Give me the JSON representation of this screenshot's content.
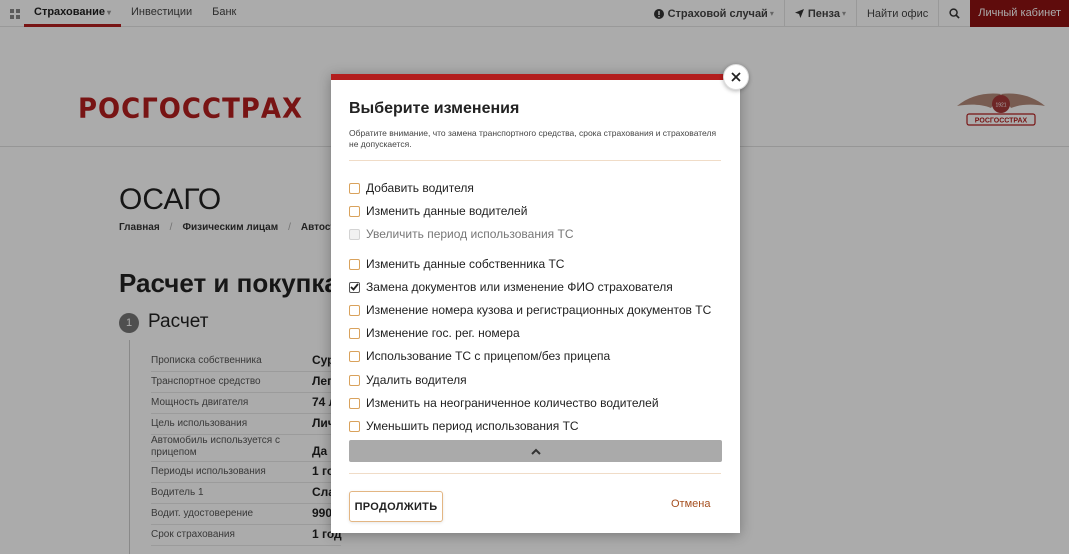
{
  "topnav": {
    "items": [
      {
        "label": "Страхование",
        "active": true,
        "has_dropdown": true
      },
      {
        "label": "Инвестиции",
        "active": false,
        "has_dropdown": false
      },
      {
        "label": "Банк",
        "active": false,
        "has_dropdown": false
      }
    ],
    "insurance_case": "Страховой случай",
    "city": "Пенза",
    "find_office": "Найти офис",
    "cabinet": "Личный кабинет"
  },
  "header": {
    "logo": "РОСГОССТРАХ",
    "emblem_text": "РОСГОССТРАХ",
    "emblem_year": "1921"
  },
  "page": {
    "title": "ОСАГО",
    "breadcrumb": [
      "Главная",
      "Физическим лицам",
      "Автострах"
    ],
    "heading": "Расчет и покупка о",
    "step_number": "1",
    "step_label": "Расчет",
    "summary": [
      {
        "key": "Прописка собственника",
        "value": "Сур"
      },
      {
        "key": "Транспортное средство",
        "value": "Лег"
      },
      {
        "key": "Мощность двигателя",
        "value": "74 л"
      },
      {
        "key": "Цель использования",
        "value": "Лич"
      },
      {
        "key": "Автомобиль используется с прицепом",
        "value": "Да"
      },
      {
        "key": "Периоды использования",
        "value": "1 го"
      },
      {
        "key": "Водитель 1",
        "value": "Сла"
      },
      {
        "key": "Водит. удостоверение",
        "value": "990"
      },
      {
        "key": "Срок страхования",
        "value": "1 год"
      }
    ]
  },
  "modal": {
    "title": "Выберите изменения",
    "note": "Обратите внимание, что замена транспортного средства, срока страхования и страхователя не допускается.",
    "options": [
      {
        "label": "Добавить водителя",
        "checked": false,
        "disabled": false
      },
      {
        "label": "Изменить данные водителей",
        "checked": false,
        "disabled": false
      },
      {
        "label": "Увеличить период использования ТС",
        "checked": false,
        "disabled": true
      },
      {
        "label": "Изменить данные собственника ТС",
        "checked": false,
        "disabled": false
      },
      {
        "label": "Замена документов или изменение ФИО страхователя",
        "checked": true,
        "disabled": false
      },
      {
        "label": "Изменение номера кузова и регистрационных документов ТС",
        "checked": false,
        "disabled": false
      },
      {
        "label": "Изменение гос. рег. номера",
        "checked": false,
        "disabled": false
      },
      {
        "label": "Использование ТС с прицепом/без прицепа",
        "checked": false,
        "disabled": false
      },
      {
        "label": "Удалить водителя",
        "checked": false,
        "disabled": false
      },
      {
        "label": "Изменить на неограниченное количество водителей",
        "checked": false,
        "disabled": false
      },
      {
        "label": "Уменьшить период использования ТС",
        "checked": false,
        "disabled": false
      }
    ],
    "continue_label": "ПРОДОЛЖИТЬ",
    "cancel_label": "Отмена",
    "close_icon": "close-icon",
    "collapse_icon": "chevron-up-icon"
  },
  "colors": {
    "brand_red": "#b31e1e",
    "cabinet_bg": "#8e1212",
    "checkbox_border": "#d9a25c",
    "cancel_link": "#a54f1f"
  }
}
